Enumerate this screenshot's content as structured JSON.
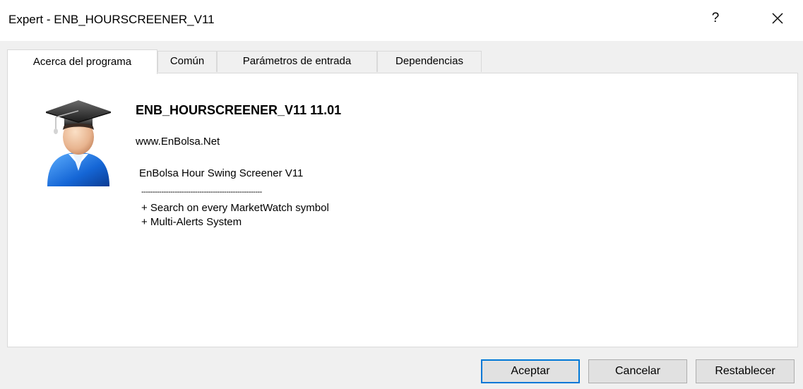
{
  "window": {
    "title": "Expert - ENB_HOURSCREENER_V11",
    "help_label": "?"
  },
  "tabs": [
    {
      "label": "Acerca del programa",
      "active": true
    },
    {
      "label": "Común",
      "active": false
    },
    {
      "label": "Parámetros de entrada",
      "active": false
    },
    {
      "label": "Dependencias",
      "active": false
    }
  ],
  "about": {
    "program_name": "ENB_HOURSCREENER_V11 11.01",
    "link": "www.EnBolsa.Net",
    "description_title": "EnBolsa Hour Swing Screener V11",
    "separator": "------------------------------------------------------",
    "features": [
      "+ Search on every MarketWatch symbol",
      "+ Multi-Alerts System"
    ],
    "icon": "graduate-avatar-icon"
  },
  "buttons": {
    "accept": "Aceptar",
    "cancel": "Cancelar",
    "reset": "Restablecer"
  },
  "colors": {
    "accent": "#0078d7",
    "background": "#f0f0f0",
    "panel": "#ffffff"
  }
}
